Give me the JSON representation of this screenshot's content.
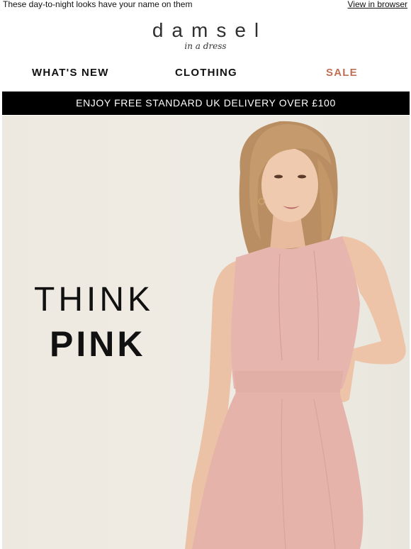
{
  "preheader": {
    "text": "These day-to-night looks have your name on them",
    "view_in_browser": "View in browser"
  },
  "brand": {
    "wordmark": "damsel",
    "tagline": "in a dress"
  },
  "nav": {
    "items": [
      {
        "label": "WHAT'S NEW"
      },
      {
        "label": "CLOTHING"
      },
      {
        "label": "SALE"
      }
    ]
  },
  "banner": {
    "text": "ENJOY FREE STANDARD UK DELIVERY OVER £100"
  },
  "hero": {
    "headline_line1": "THINK",
    "headline_line2": "PINK"
  },
  "colors": {
    "sale": "#c06f55",
    "banner_bg": "#000000",
    "hero_bg": "#eeebe4",
    "dress": "#e5b4ad"
  }
}
